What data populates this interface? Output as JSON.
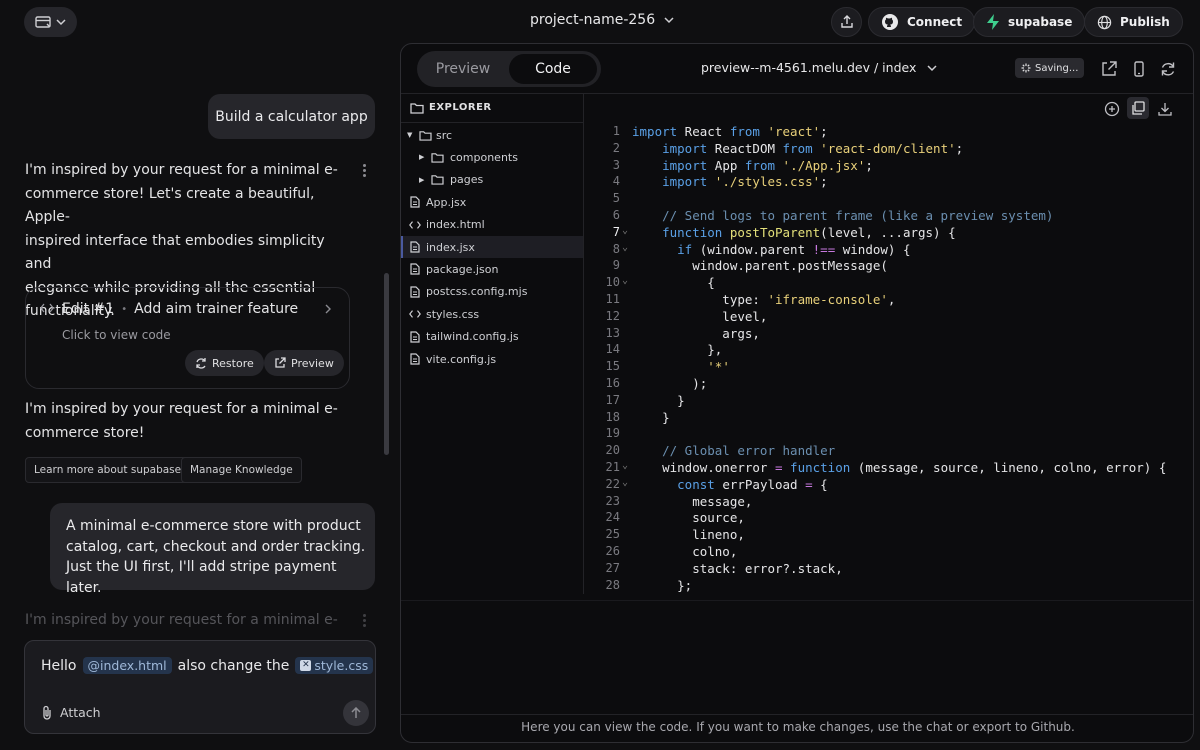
{
  "topbar": {
    "project_name": "project-name-256",
    "connect_label": "Connect",
    "supabase_label": "supabase",
    "publish_label": "Publish"
  },
  "chat": {
    "user_msg_1": "Build a calculator app",
    "assistant_msg_1": [
      "I'm inspired by your request for a minimal e-",
      "commerce store! Let's create a beautiful, Apple-",
      "inspired interface that embodies simplicity and",
      "elegance while providing all the essential",
      "functionality."
    ],
    "edit_card": {
      "edit_number": "Edit #1",
      "separator": "•",
      "title": "Add aim trainer feature",
      "subtitle": "Click to view code",
      "restore_label": "Restore",
      "preview_label": "Preview"
    },
    "assistant_msg_2": [
      "I'm inspired by your request for a minimal e-",
      "commerce store!"
    ],
    "chips": [
      "Learn more about supabase",
      "Manage Knowledge"
    ],
    "user_msg_2": [
      "A minimal e-commerce store with product",
      "catalog, cart, checkout and order tracking.",
      "Just the UI first, I'll add stripe payment later."
    ],
    "assistant_msg_3_faded": "I'm inspired by your request for a minimal e-",
    "composer": {
      "text_1": "Hello",
      "mention_1": "@index.html",
      "text_2": "also change the",
      "mention_2": "style.css",
      "attach_label": "Attach"
    }
  },
  "editor": {
    "tabs": {
      "preview": "Preview",
      "code": "Code"
    },
    "active_tab": "Code",
    "url": "preview--m-4561.melu.dev / index",
    "saving_label": "Saving...",
    "explorer": {
      "title": "EXPLORER",
      "items": [
        {
          "label": "src",
          "kind": "folder-open",
          "indent": 0
        },
        {
          "label": "components",
          "kind": "folder",
          "indent": 1
        },
        {
          "label": "pages",
          "kind": "folder",
          "indent": 1
        },
        {
          "label": "App.jsx",
          "kind": "file",
          "indent": 0
        },
        {
          "label": "index.html",
          "kind": "code",
          "indent": 0
        },
        {
          "label": "index.jsx",
          "kind": "file",
          "indent": 0,
          "active": true
        },
        {
          "label": "package.json",
          "kind": "file",
          "indent": 0
        },
        {
          "label": "postcss.config.mjs",
          "kind": "file",
          "indent": 0
        },
        {
          "label": "styles.css",
          "kind": "code",
          "indent": 0
        },
        {
          "label": "tailwind.config.js",
          "kind": "file",
          "indent": 0
        },
        {
          "label": "vite.config.js",
          "kind": "file",
          "indent": 0
        }
      ]
    },
    "code_lines": [
      {
        "n": "1",
        "t": "import React from 'react';"
      },
      {
        "n": "2",
        "t": "    import ReactDOM from 'react-dom/client';"
      },
      {
        "n": "3",
        "t": "    import App from './App.jsx';"
      },
      {
        "n": "4",
        "t": "    import './styles.css';"
      },
      {
        "n": "5",
        "t": ""
      },
      {
        "n": "6",
        "t": "    // Send logs to parent frame (like a preview system)"
      },
      {
        "n": "7",
        "t": "    function postToParent(level, ...args) {",
        "fold": true,
        "current": true
      },
      {
        "n": "8",
        "t": "      if (window.parent !== window) {",
        "fold": true
      },
      {
        "n": "9",
        "t": "        window.parent.postMessage("
      },
      {
        "n": "10",
        "t": "          {",
        "fold": true
      },
      {
        "n": "11",
        "t": "            type: 'iframe-console',"
      },
      {
        "n": "12",
        "t": "            level,"
      },
      {
        "n": "13",
        "t": "            args,"
      },
      {
        "n": "14",
        "t": "          },"
      },
      {
        "n": "15",
        "t": "          '*'"
      },
      {
        "n": "16",
        "t": "        );"
      },
      {
        "n": "17",
        "t": "      }"
      },
      {
        "n": "18",
        "t": "    }"
      },
      {
        "n": "19",
        "t": ""
      },
      {
        "n": "20",
        "t": "    // Global error handler"
      },
      {
        "n": "21",
        "t": "    window.onerror = function (message, source, lineno, colno, error) {",
        "fold": true
      },
      {
        "n": "22",
        "t": "      const errPayload = {",
        "fold": true
      },
      {
        "n": "23",
        "t": "        message,"
      },
      {
        "n": "24",
        "t": "        source,"
      },
      {
        "n": "25",
        "t": "        lineno,"
      },
      {
        "n": "26",
        "t": "        colno,"
      },
      {
        "n": "27",
        "t": "        stack: error?.stack,"
      },
      {
        "n": "28",
        "t": "      };"
      }
    ],
    "footer_note": "Here you can view the code. If you want to make changes, use the chat or export to Github."
  },
  "colors": {
    "keyword": "#5aa0e6",
    "string": "#e8d07a",
    "comment": "#6b8fb0",
    "supabase_green": "#3ecf8e"
  }
}
